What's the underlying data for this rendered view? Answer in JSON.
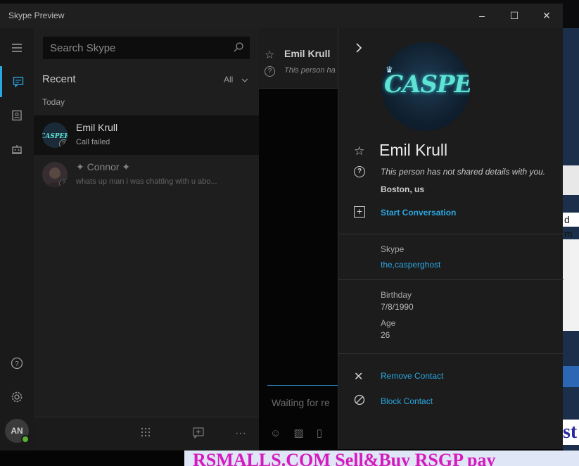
{
  "window": {
    "title": "Skype Preview",
    "minimize": "–",
    "maximize": "☐",
    "close": "✕"
  },
  "rail": {
    "icons": [
      "hamburger-icon",
      "chat-icon",
      "contacts-icon",
      "bot-icon",
      "help-icon",
      "settings-icon"
    ],
    "user_initials": "AN",
    "accent_color": "#2aa6e0",
    "presence_color": "#5ab031"
  },
  "list": {
    "search_placeholder": "Search Skype",
    "recent_label": "Recent",
    "filter_value": "All",
    "today_label": "Today",
    "conversations": [
      {
        "name": "Emil Krull",
        "preview": "Call failed",
        "avatar_text": "CASPER"
      },
      {
        "name": "✦ Connor ✦",
        "preview": "whats up man i was chatting with u abo..."
      }
    ]
  },
  "chat": {
    "contact_name": "Emil Krull",
    "contact_status": "This person ha",
    "compose_placeholder": "Waiting for re"
  },
  "profile": {
    "avatar_text": "CASPER",
    "name": "Emil Krull",
    "privacy_note": "This person has not shared details with you.",
    "location": "Boston, us",
    "start_conversation": "Start Conversation",
    "skype_label": "Skype",
    "skype_id": "the,casperghost",
    "birthday_label": "Birthday",
    "birthday": "7/8/1990",
    "age_label": "Age",
    "age": "26",
    "remove_contact": "Remove Contact",
    "block_contact": "Block Contact"
  },
  "background": {
    "banner_text": "RSMALLS.COM  Sell&Buy RSGP pay",
    "right_text": "d m",
    "corner_text": "st"
  }
}
